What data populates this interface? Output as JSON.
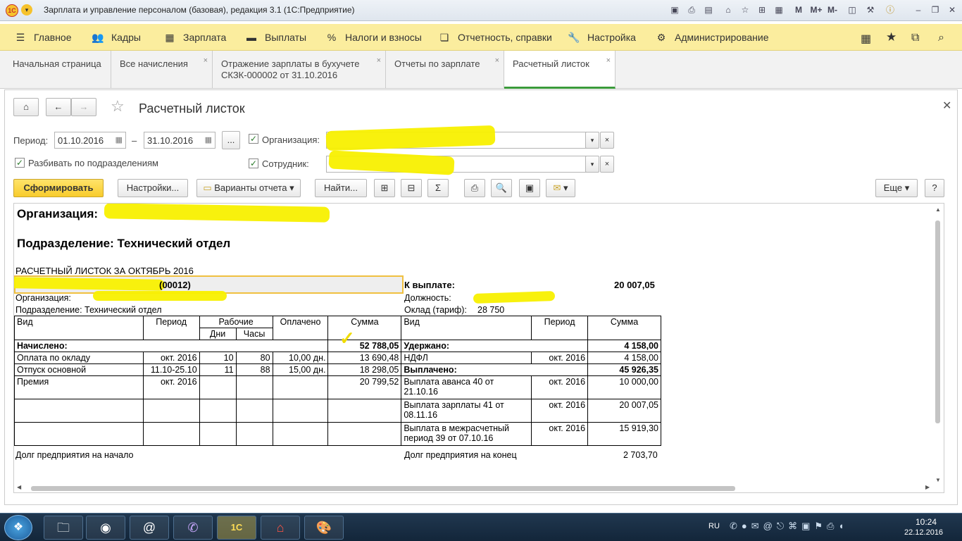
{
  "window": {
    "title": "Зарплата и управление персоналом (базовая), редакция 3.1  (1С:Предприятие)",
    "controls": [
      "M",
      "M+",
      "M-"
    ]
  },
  "menu": [
    {
      "label": "Главное",
      "icon": "hamburger-icon"
    },
    {
      "label": "Кадры",
      "icon": "people-icon"
    },
    {
      "label": "Зарплата",
      "icon": "calculator-icon"
    },
    {
      "label": "Выплаты",
      "icon": "wallet-icon"
    },
    {
      "label": "Налоги и взносы",
      "icon": "percent-icon"
    },
    {
      "label": "Отчетность, справки",
      "icon": "documents-icon"
    },
    {
      "label": "Настройка",
      "icon": "wrench-icon"
    },
    {
      "label": "Администрирование",
      "icon": "gear-icon"
    }
  ],
  "tabs": [
    {
      "label": "Начальная страница"
    },
    {
      "label": "Все начисления"
    },
    {
      "label": "Отражение зарплаты в бухучете СКЗК-000002 от 31.10.2016"
    },
    {
      "label": "Отчеты по зарплате"
    },
    {
      "label": "Расчетный листок"
    }
  ],
  "form": {
    "title": "Расчетный листок",
    "period_label": "Период:",
    "date_from": "01.10.2016",
    "dash": "–",
    "date_to": "31.10.2016",
    "ellipsis": "...",
    "org_label": "Организация:",
    "employee_label": "Сотрудник:",
    "split_label": "Разбивать по подразделениям",
    "btn_generate": "Сформировать",
    "btn_settings": "Настройки...",
    "btn_variants": "Варианты отчета",
    "btn_find": "Найти...",
    "btn_more": "Еще",
    "btn_help": "?"
  },
  "report": {
    "org_heading": "Организация:",
    "dept_heading": "Подразделение: Технический отдел",
    "sheet_title": "РАСЧЕТНЫЙ ЛИСТОК ЗА ОКТЯБРЬ 2016",
    "employee_code": "(00012)",
    "to_pay_label": "К выплате:",
    "to_pay_value": "20 007,05",
    "org_label": "Организация:",
    "position_label": "Должность:",
    "dept_line": "Подразделение:  Технический отдел",
    "rate_label": "Оклад (тариф):",
    "rate_value": "28 750",
    "headers": {
      "kind": "Вид",
      "period": "Период",
      "working": "Рабочие",
      "days": "Дни",
      "hours": "Часы",
      "paid": "Оплачено",
      "sum": "Сумма"
    },
    "accrued_label": "Начислено:",
    "accrued_total": "52 788,05",
    "withheld_label": "Удержано:",
    "withheld_total": "4 158,00",
    "paid_label": "Выплачено:",
    "paid_total": "45 926,35",
    "left_rows": [
      {
        "kind": "Оплата по окладу",
        "period": "окт. 2016",
        "days": "10",
        "hours": "80",
        "paid": "10,00 дн.",
        "sum": "13 690,48"
      },
      {
        "kind": "Отпуск основной",
        "period": "11.10-25.10",
        "days": "11",
        "hours": "88",
        "paid": "15,00 дн.",
        "sum": "18 298,05"
      },
      {
        "kind": "Премия",
        "period": "окт. 2016",
        "days": "",
        "hours": "",
        "paid": "",
        "sum": "20 799,52"
      }
    ],
    "ndfl": {
      "kind": "НДФЛ",
      "period": "окт. 2016",
      "sum": "4 158,00"
    },
    "payouts": [
      {
        "kind": "Выплата аванса 40 от 21.10.16",
        "period": "окт. 2016",
        "sum": "10 000,00"
      },
      {
        "kind": "Выплата зарплаты 41 от 08.11.16",
        "period": "окт. 2016",
        "sum": "20 007,05"
      },
      {
        "kind": "Выплата в межрасчетный период 39 от 07.10.16",
        "period": "окт. 2016",
        "sum": "15 919,30"
      }
    ],
    "debt_start_label": "Долг предприятия на начало",
    "debt_end_label": "Долг предприятия на конец",
    "debt_end_value": "2 703,70"
  },
  "taskbar": {
    "lang": "RU",
    "time": "10:24",
    "date": "22.12.2016"
  }
}
